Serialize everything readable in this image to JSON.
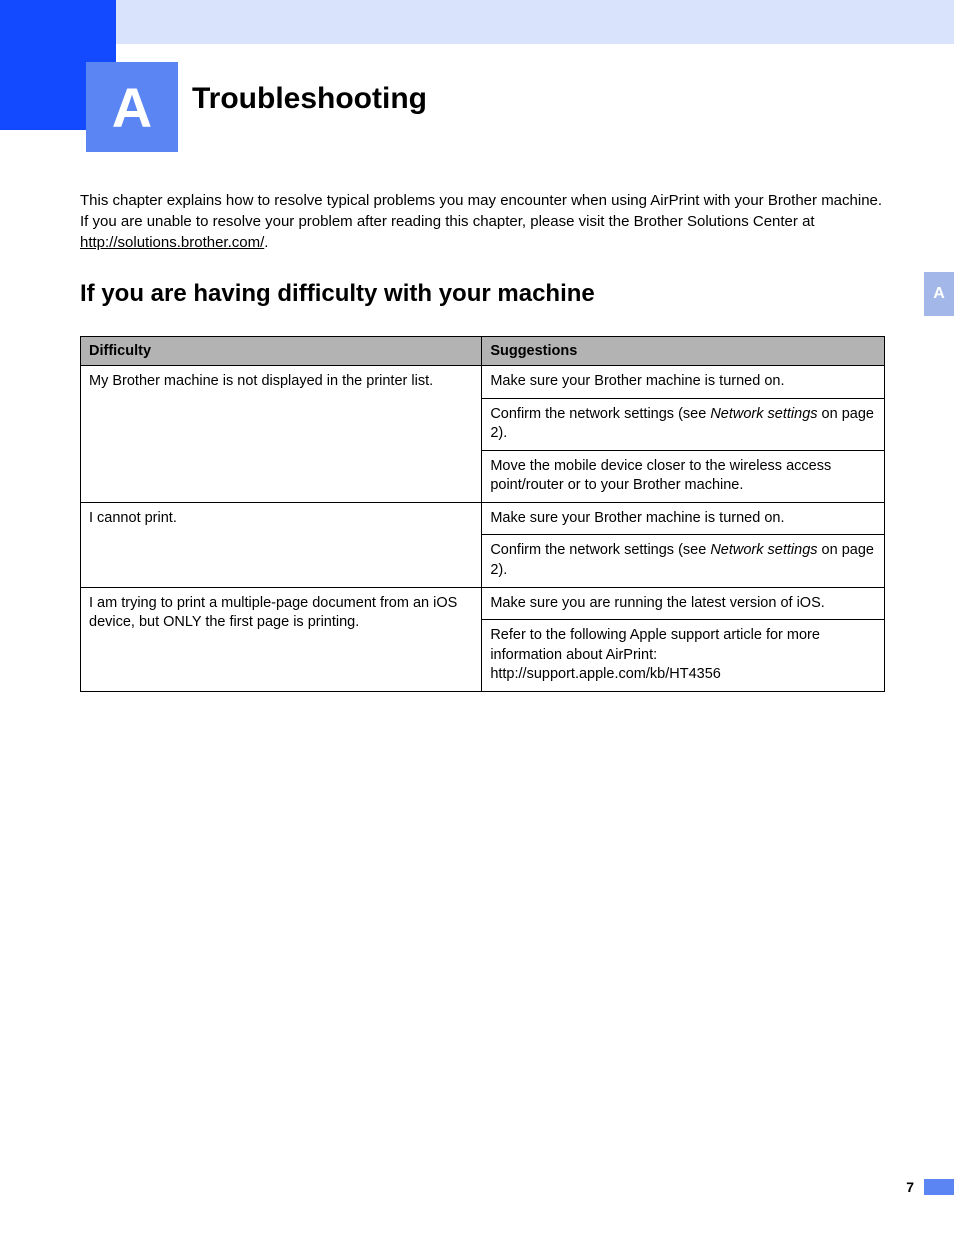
{
  "chapter": {
    "badge": "A",
    "title": "Troubleshooting"
  },
  "intro": {
    "text_before_link": "This chapter explains how to resolve typical problems you may encounter when using AirPrint with your Brother machine. If you are unable to resolve your problem after reading this chapter, please visit the Brother Solutions Center at ",
    "link_text": "http://solutions.brother.com/",
    "text_after_link": "."
  },
  "section": {
    "heading": "If you are having difficulty with your machine"
  },
  "side_tab": {
    "label": "A"
  },
  "table": {
    "headers": {
      "difficulty": "Difficulty",
      "suggestions": "Suggestions"
    },
    "rows": [
      {
        "difficulty": "My Brother machine is not displayed in the printer list.",
        "suggestions": [
          {
            "text": "Make sure your Brother machine is turned on."
          },
          {
            "prefix": "Confirm the network settings (see ",
            "italic": "Network settings",
            "suffix": " on page 2)."
          },
          {
            "text": "Move the mobile device closer to the wireless access point/router or to your Brother machine."
          }
        ]
      },
      {
        "difficulty": "I cannot print.",
        "suggestions": [
          {
            "text": "Make sure your Brother machine is turned on."
          },
          {
            "prefix": "Confirm the network settings (see ",
            "italic": "Network settings",
            "suffix": " on page 2)."
          }
        ]
      },
      {
        "difficulty": "I am trying to print a multiple-page document from an iOS device, but ONLY the first page is printing.",
        "suggestions": [
          {
            "text": "Make sure you are running the latest version of iOS."
          },
          {
            "text": "Refer to the following Apple support article for more information about AirPrint: http://support.apple.com/kb/HT4356"
          }
        ]
      }
    ]
  },
  "page_number": "7"
}
